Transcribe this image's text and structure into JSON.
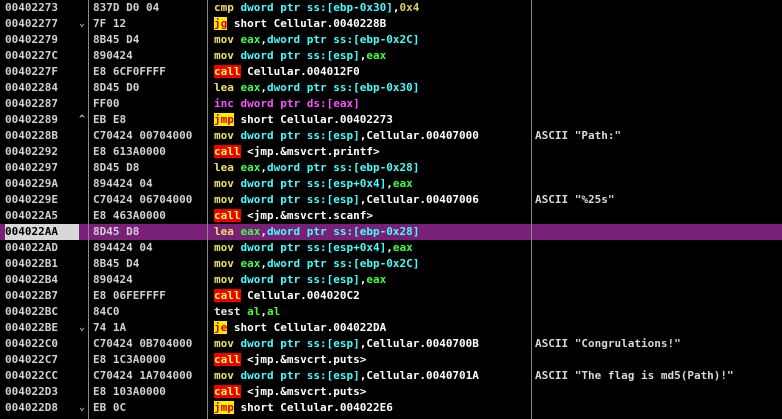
{
  "window": {
    "panel": "CPU disassembly",
    "selected_address": "004022AA"
  },
  "colors": {
    "background": "#000000",
    "selected_row": "#7a1f7a",
    "call_bg": "#ee0000",
    "call_fg": "#ffff40",
    "jump_bg": "#ffee00",
    "jump_fg": "#dd0000",
    "register": "#40ff40",
    "memory_operand": "#40ffff",
    "mnemonic": "#f0e060",
    "inc_mnemonic": "#ff50ff"
  },
  "rows": [
    {
      "address": "00402273",
      "jmark": "",
      "hex": "837D D0 04",
      "mnemonic": "cmp",
      "mclass": "cmp",
      "operands": [
        {
          "t": "dword ptr ",
          "c": "kw-size"
        },
        {
          "t": "ss:[ebp-0x30]",
          "c": "kw-mem"
        },
        {
          "t": ",",
          "c": "opd"
        },
        {
          "t": "0x4",
          "c": "kw-imm"
        }
      ],
      "comment": ""
    },
    {
      "address": "00402277",
      "jmark": "⌄",
      "hex": "7F 12",
      "mnemonic": "jg",
      "mclass": "jcc",
      "operands": [
        {
          "t": "short Cellular.0040228B",
          "c": "kw-sym"
        }
      ],
      "comment": ""
    },
    {
      "address": "00402279",
      "jmark": "",
      "hex": "8B45 D4",
      "mnemonic": "mov",
      "mclass": "mov",
      "operands": [
        {
          "t": "eax",
          "c": "kw-reg"
        },
        {
          "t": ",",
          "c": "opd"
        },
        {
          "t": "dword ptr ",
          "c": "kw-size"
        },
        {
          "t": "ss:[ebp-0x2C]",
          "c": "kw-mem"
        }
      ],
      "comment": ""
    },
    {
      "address": "0040227C",
      "jmark": "",
      "hex": "890424",
      "mnemonic": "mov",
      "mclass": "mov",
      "operands": [
        {
          "t": "dword ptr ",
          "c": "kw-size"
        },
        {
          "t": "ss:[esp]",
          "c": "kw-mem"
        },
        {
          "t": ",",
          "c": "opd"
        },
        {
          "t": "eax",
          "c": "kw-reg"
        }
      ],
      "comment": ""
    },
    {
      "address": "0040227F",
      "jmark": "",
      "hex": "E8 6CF0FFFF",
      "mnemonic": "call",
      "mclass": "call",
      "operands": [
        {
          "t": "Cellular.004012F0",
          "c": "kw-sym"
        }
      ],
      "comment": ""
    },
    {
      "address": "00402284",
      "jmark": "",
      "hex": "8D45 D0",
      "mnemonic": "lea",
      "mclass": "lea",
      "operands": [
        {
          "t": "eax",
          "c": "kw-reg"
        },
        {
          "t": ",",
          "c": "opd"
        },
        {
          "t": "dword ptr ",
          "c": "kw-size"
        },
        {
          "t": "ss:[ebp-0x30]",
          "c": "kw-mem"
        }
      ],
      "comment": ""
    },
    {
      "address": "00402287",
      "jmark": "",
      "hex": "FF00",
      "mnemonic": "inc",
      "mclass": "inc",
      "operands": [
        {
          "t": "dword ptr ",
          "c": "kw-ds"
        },
        {
          "t": "ds:[eax]",
          "c": "kw-ds"
        }
      ],
      "comment": ""
    },
    {
      "address": "00402289",
      "jmark": "^",
      "hex": "EB E8",
      "mnemonic": "jmp",
      "mclass": "jmp",
      "operands": [
        {
          "t": "short Cellular.00402273",
          "c": "kw-sym"
        }
      ],
      "comment": ""
    },
    {
      "address": "0040228B",
      "jmark": "",
      "hex": "C70424 00704000",
      "mnemonic": "mov",
      "mclass": "mov",
      "operands": [
        {
          "t": "dword ptr ",
          "c": "kw-size"
        },
        {
          "t": "ss:[esp]",
          "c": "kw-mem"
        },
        {
          "t": ",",
          "c": "opd"
        },
        {
          "t": "Cellular.00407000",
          "c": "kw-sym"
        }
      ],
      "comment": "ASCII \"Path:\""
    },
    {
      "address": "00402292",
      "jmark": "",
      "hex": "E8 613A0000",
      "mnemonic": "call",
      "mclass": "call",
      "operands": [
        {
          "t": "<jmp.&msvcrt.printf>",
          "c": "kw-sym"
        }
      ],
      "comment": ""
    },
    {
      "address": "00402297",
      "jmark": "",
      "hex": "8D45 D8",
      "mnemonic": "lea",
      "mclass": "lea",
      "operands": [
        {
          "t": "eax",
          "c": "kw-reg"
        },
        {
          "t": ",",
          "c": "opd"
        },
        {
          "t": "dword ptr ",
          "c": "kw-size"
        },
        {
          "t": "ss:[ebp-0x28]",
          "c": "kw-mem"
        }
      ],
      "comment": ""
    },
    {
      "address": "0040229A",
      "jmark": "",
      "hex": "894424 04",
      "mnemonic": "mov",
      "mclass": "mov",
      "operands": [
        {
          "t": "dword ptr ",
          "c": "kw-size"
        },
        {
          "t": "ss:[esp+0x4]",
          "c": "kw-mem"
        },
        {
          "t": ",",
          "c": "opd"
        },
        {
          "t": "eax",
          "c": "kw-reg"
        }
      ],
      "comment": ""
    },
    {
      "address": "0040229E",
      "jmark": "",
      "hex": "C70424 06704000",
      "mnemonic": "mov",
      "mclass": "mov",
      "operands": [
        {
          "t": "dword ptr ",
          "c": "kw-size"
        },
        {
          "t": "ss:[esp]",
          "c": "kw-mem"
        },
        {
          "t": ",",
          "c": "opd"
        },
        {
          "t": "Cellular.00407006",
          "c": "kw-sym"
        }
      ],
      "comment": "ASCII \"%25s\""
    },
    {
      "address": "004022A5",
      "jmark": "",
      "hex": "E8 463A0000",
      "mnemonic": "call",
      "mclass": "call",
      "operands": [
        {
          "t": "<jmp.&msvcrt.scanf>",
          "c": "kw-sym"
        }
      ],
      "comment": ""
    },
    {
      "address": "004022AA",
      "jmark": "",
      "hex": "8D45 D8",
      "mnemonic": "lea",
      "mclass": "lea",
      "selected": true,
      "operands": [
        {
          "t": "eax",
          "c": "kw-reg"
        },
        {
          "t": ",",
          "c": "opd"
        },
        {
          "t": "dword ptr ",
          "c": "kw-size"
        },
        {
          "t": "ss:[ebp-0x28]",
          "c": "kw-mem"
        }
      ],
      "comment": ""
    },
    {
      "address": "004022AD",
      "jmark": "",
      "hex": "894424 04",
      "mnemonic": "mov",
      "mclass": "mov",
      "operands": [
        {
          "t": "dword ptr ",
          "c": "kw-size"
        },
        {
          "t": "ss:[esp+0x4]",
          "c": "kw-mem"
        },
        {
          "t": ",",
          "c": "opd"
        },
        {
          "t": "eax",
          "c": "kw-reg"
        }
      ],
      "comment": ""
    },
    {
      "address": "004022B1",
      "jmark": "",
      "hex": "8B45 D4",
      "mnemonic": "mov",
      "mclass": "mov",
      "operands": [
        {
          "t": "eax",
          "c": "kw-reg"
        },
        {
          "t": ",",
          "c": "opd"
        },
        {
          "t": "dword ptr ",
          "c": "kw-size"
        },
        {
          "t": "ss:[ebp-0x2C]",
          "c": "kw-mem"
        }
      ],
      "comment": ""
    },
    {
      "address": "004022B4",
      "jmark": "",
      "hex": "890424",
      "mnemonic": "mov",
      "mclass": "mov",
      "operands": [
        {
          "t": "dword ptr ",
          "c": "kw-size"
        },
        {
          "t": "ss:[esp]",
          "c": "kw-mem"
        },
        {
          "t": ",",
          "c": "opd"
        },
        {
          "t": "eax",
          "c": "kw-reg"
        }
      ],
      "comment": ""
    },
    {
      "address": "004022B7",
      "jmark": "",
      "hex": "E8 06FEFFFF",
      "mnemonic": "call",
      "mclass": "call",
      "operands": [
        {
          "t": "Cellular.004020C2",
          "c": "kw-sym"
        }
      ],
      "comment": ""
    },
    {
      "address": "004022BC",
      "jmark": "",
      "hex": "84C0",
      "mnemonic": "test",
      "mclass": "test",
      "operands": [
        {
          "t": "al",
          "c": "kw-reg"
        },
        {
          "t": ",",
          "c": "opd"
        },
        {
          "t": "al",
          "c": "kw-reg"
        }
      ],
      "comment": ""
    },
    {
      "address": "004022BE",
      "jmark": "⌄",
      "hex": "74 1A",
      "mnemonic": "je",
      "mclass": "jcc",
      "operands": [
        {
          "t": "short Cellular.004022DA",
          "c": "kw-sym"
        }
      ],
      "comment": ""
    },
    {
      "address": "004022C0",
      "jmark": "",
      "hex": "C70424 0B704000",
      "mnemonic": "mov",
      "mclass": "mov",
      "operands": [
        {
          "t": "dword ptr ",
          "c": "kw-size"
        },
        {
          "t": "ss:[esp]",
          "c": "kw-mem"
        },
        {
          "t": ",",
          "c": "opd"
        },
        {
          "t": "Cellular.0040700B",
          "c": "kw-sym"
        }
      ],
      "comment": "ASCII \"Congrulations!\""
    },
    {
      "address": "004022C7",
      "jmark": "",
      "hex": "E8 1C3A0000",
      "mnemonic": "call",
      "mclass": "call",
      "operands": [
        {
          "t": "<jmp.&msvcrt.puts>",
          "c": "kw-sym"
        }
      ],
      "comment": ""
    },
    {
      "address": "004022CC",
      "jmark": "",
      "hex": "C70424 1A704000",
      "mnemonic": "mov",
      "mclass": "mov",
      "operands": [
        {
          "t": "dword ptr ",
          "c": "kw-size"
        },
        {
          "t": "ss:[esp]",
          "c": "kw-mem"
        },
        {
          "t": ",",
          "c": "opd"
        },
        {
          "t": "Cellular.0040701A",
          "c": "kw-sym"
        }
      ],
      "comment": "ASCII \"The flag is md5(Path)!\""
    },
    {
      "address": "004022D3",
      "jmark": "",
      "hex": "E8 103A0000",
      "mnemonic": "call",
      "mclass": "call",
      "operands": [
        {
          "t": "<jmp.&msvcrt.puts>",
          "c": "kw-sym"
        }
      ],
      "comment": ""
    },
    {
      "address": "004022D8",
      "jmark": "⌄",
      "hex": "EB 0C",
      "mnemonic": "jmp",
      "mclass": "jmp",
      "operands": [
        {
          "t": "short Cellular.004022E6",
          "c": "kw-sym"
        }
      ],
      "comment": ""
    }
  ]
}
